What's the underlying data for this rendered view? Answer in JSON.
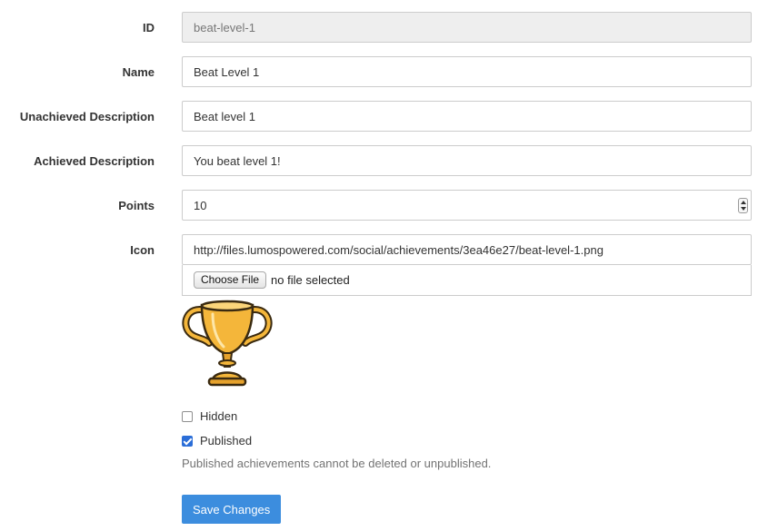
{
  "form": {
    "id": {
      "label": "ID",
      "value": "beat-level-1"
    },
    "name": {
      "label": "Name",
      "value": "Beat Level 1"
    },
    "unachieved_description": {
      "label": "Unachieved Description",
      "value": "Beat level 1"
    },
    "achieved_description": {
      "label": "Achieved Description",
      "value": "You beat level 1!"
    },
    "points": {
      "label": "Points",
      "value": "10"
    },
    "icon": {
      "label": "Icon",
      "url": "http://files.lumospowered.com/social/achievements/3ea46e27/beat-level-1.png",
      "choose_file_label": "Choose File",
      "file_status": "no file selected",
      "preview_icon": "trophy-icon"
    },
    "hidden": {
      "label": "Hidden",
      "checked": false
    },
    "published": {
      "label": "Published",
      "checked": true
    },
    "published_help": "Published achievements cannot be deleted or unpublished.",
    "save_label": "Save Changes"
  },
  "colors": {
    "primary_button": "#3c8dde",
    "checkbox_checked": "#2b6ed8",
    "readonly_bg": "#eeeeee",
    "trophy_gold": "#f4b63a"
  }
}
